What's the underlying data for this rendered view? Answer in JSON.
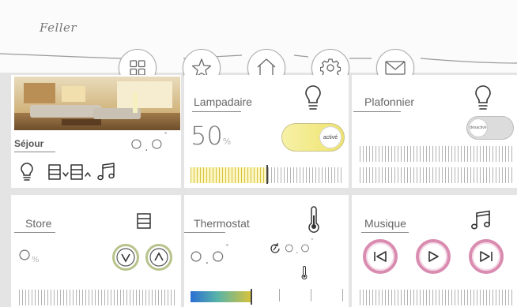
{
  "brand": {
    "logo_text": "Feller"
  },
  "nav": {
    "items": [
      {
        "name": "grid"
      },
      {
        "name": "favorites"
      },
      {
        "name": "home"
      },
      {
        "name": "settings"
      },
      {
        "name": "mail"
      }
    ]
  },
  "sejour": {
    "title": "Séjour",
    "value": "○.○",
    "unit": "°"
  },
  "lampadaire": {
    "title": "Lampadaire",
    "value": "50",
    "unit": "%",
    "toggle_label": "activé",
    "toggle_on": true
  },
  "plafonnier": {
    "title": "Plafonnier",
    "toggle_label": "désactivé",
    "toggle_on": false
  },
  "store": {
    "title": "Store",
    "value": "○",
    "unit": "%"
  },
  "thermostat": {
    "title": "Thermostat",
    "value": "○.○",
    "unit": "°",
    "setpoint": "○.○",
    "setpoint_unit": "°"
  },
  "musique": {
    "title": "Musique"
  },
  "colors": {
    "accent_pink": "#d98bb0",
    "toggle_yellow": "#f3ed8a",
    "accent_green": "#b7c38a"
  }
}
